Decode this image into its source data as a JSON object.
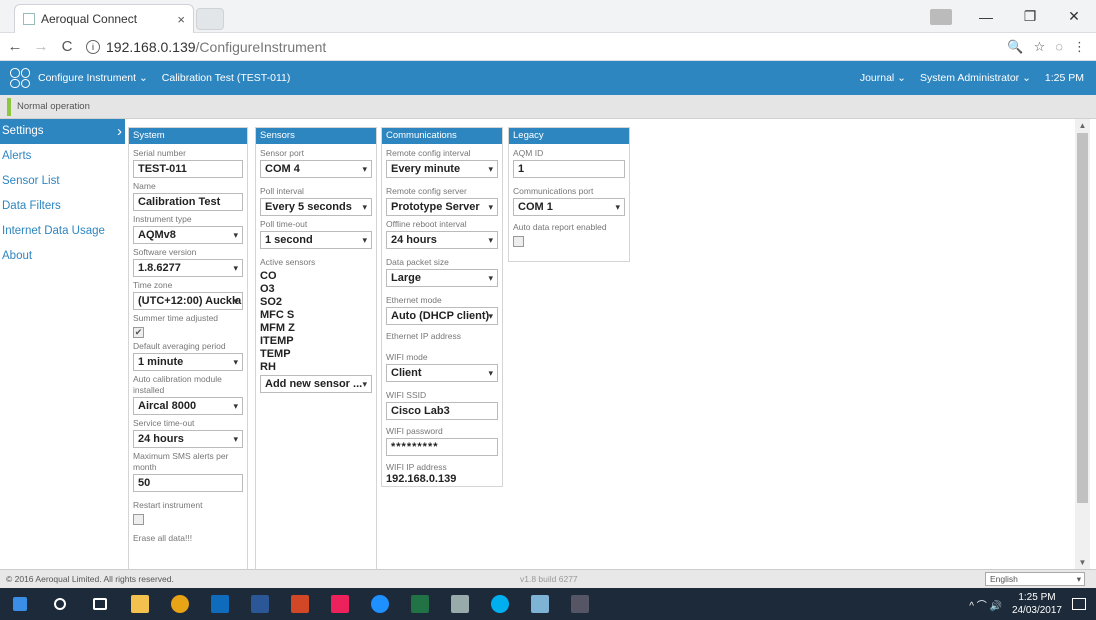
{
  "browser": {
    "tab_title": "Aeroqual Connect",
    "tab_close": "×",
    "url_host": "192.168.0.139",
    "url_path": "/ConfigureInstrument",
    "back": "←",
    "forward": "→",
    "reload": "C",
    "info": "i",
    "zoom": "🔍",
    "star": "☆",
    "ext": "◌",
    "menu": "⋮",
    "minimize": "—",
    "maximize": "❐",
    "close": "✕"
  },
  "header": {
    "nav1": "Configure Instrument ⌄",
    "nav2": "Calibration Test (TEST-011)",
    "journal": "Journal ⌄",
    "user": "System Administrator ⌄",
    "time": "1:25 PM"
  },
  "status": "Normal operation",
  "sidebar": {
    "items": [
      {
        "label": "Settings"
      },
      {
        "label": "Alerts"
      },
      {
        "label": "Sensor List"
      },
      {
        "label": "Data Filters"
      },
      {
        "label": "Internet Data Usage"
      },
      {
        "label": "About"
      }
    ]
  },
  "system": {
    "title": "System",
    "serial_label": "Serial number",
    "serial": "TEST-011",
    "name_label": "Name",
    "name": "Calibration Test",
    "type_label": "Instrument type",
    "type": "AQMv8",
    "sw_label": "Software version",
    "sw": "1.8.6277",
    "tz_label": "Time zone",
    "tz": "(UTC+12:00) Aucklan",
    "summer_label": "Summer time adjusted",
    "summer_check": "✔",
    "avg_label": "Default averaging period",
    "avg": "1 minute",
    "autocal_label": "Auto calibration module installed",
    "autocal": "Aircal 8000",
    "svc_label": "Service time-out",
    "svc": "24 hours",
    "sms_label": "Maximum SMS alerts per month",
    "sms": "50",
    "restart_label": "Restart instrument",
    "erase_label": "Erase all data!!!"
  },
  "sensors": {
    "title": "Sensors",
    "port_label": "Sensor port",
    "port": "COM 4",
    "poll_label": "Poll interval",
    "poll": "Every 5 seconds",
    "timeout_label": "Poll time-out",
    "timeout": "1 second",
    "active_label": "Active sensors",
    "active": [
      "CO",
      "O3",
      "SO2",
      "MFC S",
      "MFM Z",
      "ITEMP",
      "TEMP",
      "RH"
    ],
    "add": "Add new sensor ..."
  },
  "comms": {
    "title": "Communications",
    "rci_label": "Remote config interval",
    "rci": "Every minute",
    "rcs_label": "Remote config server",
    "rcs": "Prototype Server",
    "reboot_label": "Offline reboot interval",
    "reboot": "24 hours",
    "packet_label": "Data packet size",
    "packet": "Large",
    "eth_label": "Ethernet mode",
    "eth": "Auto (DHCP client)",
    "ethip_label": "Ethernet IP address",
    "wifimode_label": "WIFI mode",
    "wifimode": "Client",
    "ssid_label": "WIFI SSID",
    "ssid": "Cisco Lab3",
    "pwd_label": "WIFI password",
    "pwd": "*********",
    "wifiip_label": "WIFI IP address",
    "wifiip": "192.168.0.139"
  },
  "legacy": {
    "title": "Legacy",
    "aqm_label": "AQM ID",
    "aqm": "1",
    "port_label": "Communications port",
    "port": "COM 1",
    "auto_label": "Auto data report enabled"
  },
  "footer": {
    "copyright": "© 2016 Aeroqual Limited. All rights reserved.",
    "build": "v1.8 build 6277",
    "language": "English"
  },
  "taskbar": {
    "tray": "^ ⌒ 🔊",
    "time": "1:25 PM",
    "date": "24/03/2017"
  }
}
